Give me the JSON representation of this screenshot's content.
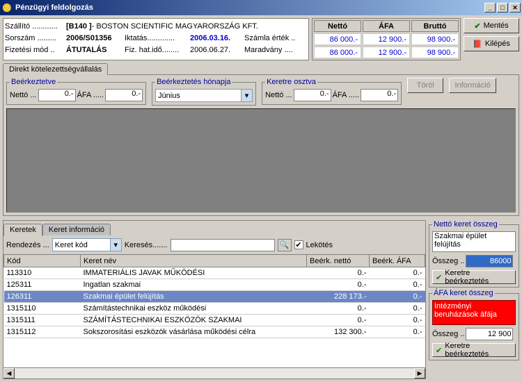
{
  "window": {
    "title": "Pénzügyi feldolgozás"
  },
  "supplier": {
    "label": "Szállító ............",
    "code": "[B140    ]",
    "name": " - BOSTON SCIENTIFIC MAGYARORSZÁG KFT."
  },
  "serial": {
    "label": "Sorszám .........",
    "value": "2006/S01356"
  },
  "iktatas": {
    "label": "Iktatás.............",
    "value": "2006.03.16."
  },
  "invoice_value": {
    "label": "Számla érték .."
  },
  "payment": {
    "label": "Fizetési mód ..",
    "value": "ÁTUTALÁS"
  },
  "fizhat": {
    "label": "Fiz. hat.idő........",
    "value": "2006.06.27."
  },
  "remainder": {
    "label": "Maradvány ...."
  },
  "sum_headers": {
    "netto": "Nettó",
    "afa": "ÁFA",
    "brutto": "Bruttó"
  },
  "sum_row1": {
    "netto": "86 000.-",
    "afa": "12 900.-",
    "brutto": "98 900.-"
  },
  "sum_row2": {
    "netto": "86 000.-",
    "afa": "12 900.-",
    "brutto": "98 900.-"
  },
  "buttons": {
    "save": "Mentés",
    "exit": "Kilépés",
    "delete": "Töröl",
    "info": "Információ",
    "keret_beerk": "Keretre beérkeztetés"
  },
  "tab1": "Direkt kötelezettségvállalás",
  "fs1": {
    "legend": "Beérkeztetve",
    "netto_lbl": "Nettó ...",
    "netto": "0.-",
    "afa_lbl": "ÁFA .....",
    "afa": "0.-"
  },
  "fs2": {
    "legend": "Beérkeztetés hónapja",
    "value": "Június"
  },
  "fs3": {
    "legend": "Keretre osztva",
    "netto_lbl": "Nettó ...",
    "netto": "0.-",
    "afa_lbl": "ÁFA .....",
    "afa": "0.-"
  },
  "tabs2": {
    "t1": "Keretek",
    "t2": "Keret információ"
  },
  "search": {
    "sort_lbl": "Rendezés ...",
    "sort_val": "Keret kód",
    "search_lbl": "Keresés.......",
    "lekotes": "Lekötés"
  },
  "grid": {
    "headers": {
      "kod": "Kód",
      "nev": "Keret név",
      "netto": "Beérk. nettó",
      "afa": "Beérk. ÁFA"
    },
    "rows": [
      {
        "kod": "113310",
        "nev": "IMMATERIÁLIS JAVAK MŰKÖDÉSI",
        "netto": "0.-",
        "afa": "0.-"
      },
      {
        "kod": "125311",
        "nev": "Ingatlan szakmai",
        "netto": "0.-",
        "afa": "0.-"
      },
      {
        "kod": "126311",
        "nev": "Szakmai épület felújítás",
        "netto": "228 173.-",
        "afa": "0.-",
        "sel": true
      },
      {
        "kod": "1315110",
        "nev": "Számítástechnikai eszköz    működési",
        "netto": "0.-",
        "afa": "0.-"
      },
      {
        "kod": "1315111",
        "nev": "SZÁMÍTÁSTECHNIKAI ESZKÖZÖK SZAKMAI",
        "netto": "0.-",
        "afa": "0.-"
      },
      {
        "kod": "1315112",
        "nev": "Sokszorosítási eszközök vásárlása működési célra",
        "netto": "132 300.-",
        "afa": "0.-"
      }
    ]
  },
  "netto_keret": {
    "legend": "Nettó keret összeg",
    "name": "Szakmai épület felújítás",
    "osszeg_lbl": "Összeg ..",
    "osszeg": "86000"
  },
  "afa_keret": {
    "legend": "ÁFA keret összeg",
    "name": "Intézményi beruházások áfája",
    "osszeg_lbl": "Összeg ..",
    "osszeg": "12 900"
  },
  "icons": {
    "check": "✔",
    "exit": "⎋",
    "search": "🔍",
    "down": "▾",
    "left": "◄",
    "right": "►",
    "min": "_",
    "max": "□",
    "close": "✕",
    "app": "🪙"
  }
}
